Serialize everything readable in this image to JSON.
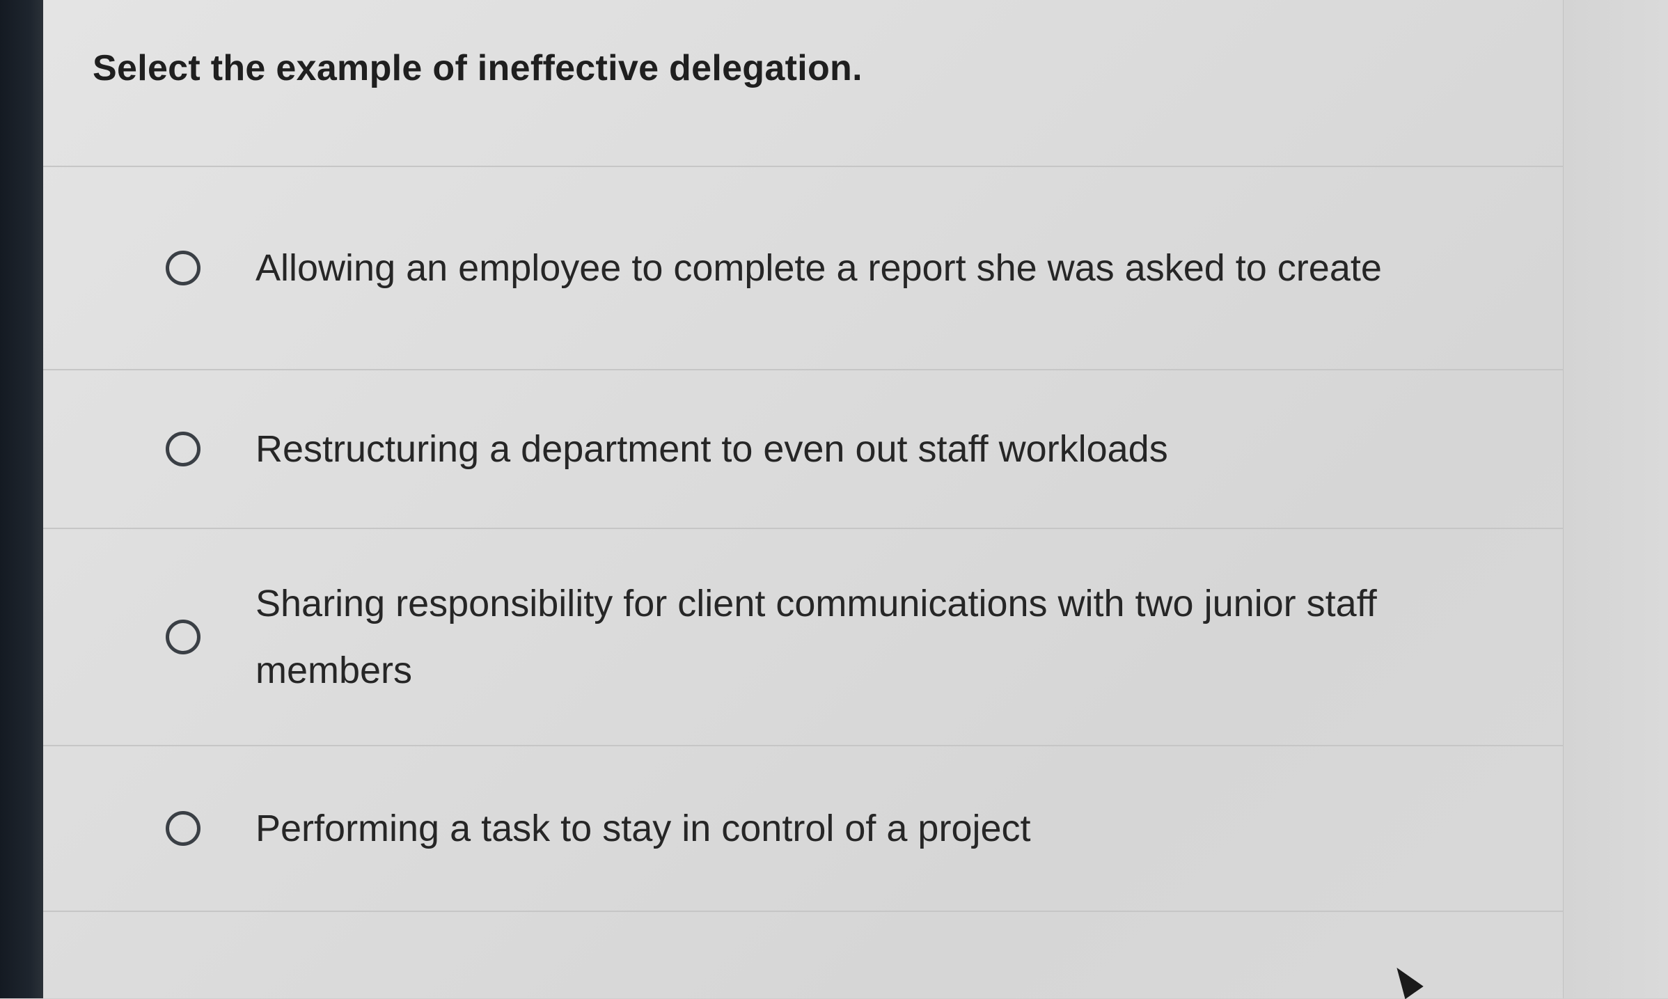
{
  "question": {
    "text": "Select the example of ineffective delegation."
  },
  "options": [
    {
      "label": "Allowing an employee to complete a report she was asked to create",
      "selected": false
    },
    {
      "label": "Restructuring a department to even out staff workloads",
      "selected": false
    },
    {
      "label": "Sharing responsibility for client communications with two junior staff members",
      "selected": false
    },
    {
      "label": "Performing a task to stay in control of a project",
      "selected": false
    }
  ]
}
